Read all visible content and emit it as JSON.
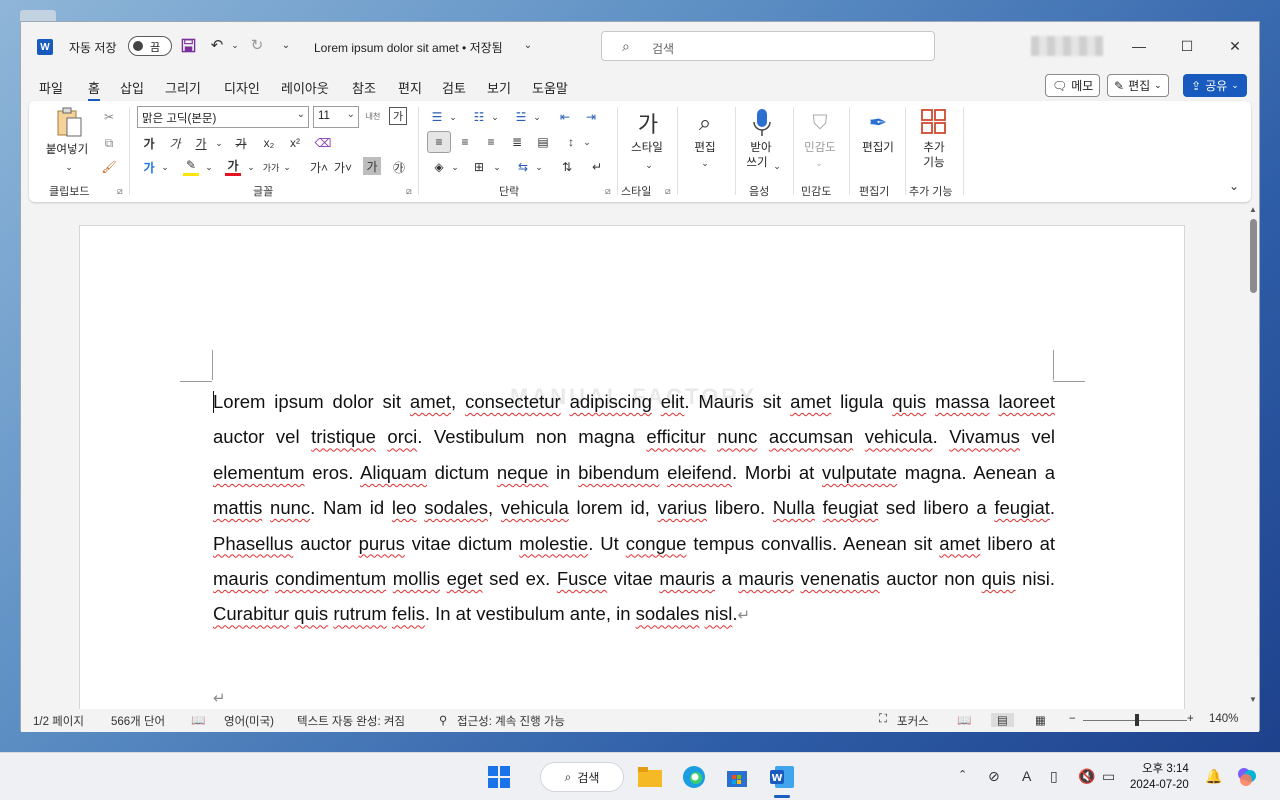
{
  "titlebar": {
    "app_icon": "W",
    "autosave_label": "자동 저장",
    "autosave_state": "끔",
    "doc_title": "Lorem ipsum dolor sit amet • 저장됨",
    "search_placeholder": "검색"
  },
  "menu": {
    "items": [
      "파일",
      "홈",
      "삽입",
      "그리기",
      "디자인",
      "레이아웃",
      "참조",
      "편지",
      "검토",
      "보기",
      "도움말"
    ],
    "active": "홈",
    "comment_label": "메모",
    "edit_label": "편집",
    "share_label": "공유"
  },
  "ribbon": {
    "clipboard": {
      "paste_label": "붙여넣기",
      "group_label": "클립보드"
    },
    "font": {
      "font_name": "맑은 고딕(본문)",
      "font_size": "11",
      "group_label": "글꼴",
      "bold": "가",
      "italic": "가",
      "underline": "가",
      "strike": "가",
      "sub": "x₂",
      "sup": "x²",
      "grow": "가˄",
      "shrink": "가˅",
      "case_btn": "가가",
      "char_shade": "가",
      "enclose": "㉮",
      "highlight_color": "#ffe600",
      "font_color_bar": "#e81123",
      "text_effect": "가",
      "phonetic": "내천",
      "char_border": "가"
    },
    "paragraph": {
      "group_label": "단락"
    },
    "styles": {
      "label": "스타일",
      "group_label": "스타일"
    },
    "editing": {
      "label": "편집"
    },
    "voice": {
      "label_line1": "받아",
      "label_line2": "쓰기",
      "group_label": "음성"
    },
    "sensitivity": {
      "label": "민감도",
      "group_label": "민감도"
    },
    "editor": {
      "label": "편집기",
      "group_label": "편집기"
    },
    "addins": {
      "label_line1": "추가",
      "label_line2": "기능",
      "group_label": "추가 기능"
    }
  },
  "document": {
    "watermark": "MANUAL FACTORY",
    "runs": [
      {
        "t": "Lorem ipsum dolor sit ",
        "s": false
      },
      {
        "t": "amet",
        "s": true
      },
      {
        "t": ", ",
        "s": false
      },
      {
        "t": "consectetur",
        "s": true
      },
      {
        "t": " ",
        "s": false
      },
      {
        "t": "adipiscing",
        "s": true
      },
      {
        "t": " ",
        "s": false
      },
      {
        "t": "elit",
        "s": true
      },
      {
        "t": ". Mauris sit ",
        "s": false
      },
      {
        "t": "amet",
        "s": true
      },
      {
        "t": " ligula ",
        "s": false
      },
      {
        "t": "quis",
        "s": true
      },
      {
        "t": " ",
        "s": false
      },
      {
        "t": "massa",
        "s": true
      },
      {
        "t": " ",
        "s": false
      },
      {
        "t": "laoreet",
        "s": true
      },
      {
        "t": " auctor vel ",
        "s": false
      },
      {
        "t": "tristique",
        "s": true
      },
      {
        "t": " ",
        "s": false
      },
      {
        "t": "orci",
        "s": true
      },
      {
        "t": ". Vestibulum non magna ",
        "s": false
      },
      {
        "t": "efficitur",
        "s": true
      },
      {
        "t": " ",
        "s": false
      },
      {
        "t": "nunc",
        "s": true
      },
      {
        "t": " ",
        "s": false
      },
      {
        "t": "accumsan",
        "s": true
      },
      {
        "t": " ",
        "s": false
      },
      {
        "t": "vehicula",
        "s": true
      },
      {
        "t": ". ",
        "s": false
      },
      {
        "t": "Vivamus",
        "s": true
      },
      {
        "t": " vel ",
        "s": false
      },
      {
        "t": "elementum",
        "s": true
      },
      {
        "t": " eros. ",
        "s": false
      },
      {
        "t": "Aliquam",
        "s": true
      },
      {
        "t": " dictum ",
        "s": false
      },
      {
        "t": "neque",
        "s": true
      },
      {
        "t": " in ",
        "s": false
      },
      {
        "t": "bibendum",
        "s": true
      },
      {
        "t": " ",
        "s": false
      },
      {
        "t": "eleifend",
        "s": true
      },
      {
        "t": ". Morbi at ",
        "s": false
      },
      {
        "t": "vulputate",
        "s": true
      },
      {
        "t": " magna. Aenean a ",
        "s": false
      },
      {
        "t": "mattis",
        "s": true
      },
      {
        "t": " ",
        "s": false
      },
      {
        "t": "nunc",
        "s": true
      },
      {
        "t": ". Nam id ",
        "s": false
      },
      {
        "t": "leo",
        "s": true
      },
      {
        "t": " ",
        "s": false
      },
      {
        "t": "sodales",
        "s": true
      },
      {
        "t": ", ",
        "s": false
      },
      {
        "t": "vehicula",
        "s": true
      },
      {
        "t": " lorem id, ",
        "s": false
      },
      {
        "t": "varius",
        "s": true
      },
      {
        "t": " libero. ",
        "s": false
      },
      {
        "t": "Nulla",
        "s": true
      },
      {
        "t": " ",
        "s": false
      },
      {
        "t": "feugiat",
        "s": true
      },
      {
        "t": " sed libero a ",
        "s": false
      },
      {
        "t": "feugiat",
        "s": true
      },
      {
        "t": ". ",
        "s": false
      },
      {
        "t": "Phasellus",
        "s": true
      },
      {
        "t": " auctor ",
        "s": false
      },
      {
        "t": "purus",
        "s": true
      },
      {
        "t": " vitae dictum ",
        "s": false
      },
      {
        "t": "molestie",
        "s": true
      },
      {
        "t": ". Ut ",
        "s": false
      },
      {
        "t": "congue",
        "s": true
      },
      {
        "t": " tempus convallis. Aenean sit ",
        "s": false
      },
      {
        "t": "amet",
        "s": true
      },
      {
        "t": " libero at ",
        "s": false
      },
      {
        "t": "mauris",
        "s": true
      },
      {
        "t": " ",
        "s": false
      },
      {
        "t": "condimentum",
        "s": true
      },
      {
        "t": " ",
        "s": false
      },
      {
        "t": "mollis",
        "s": true
      },
      {
        "t": " ",
        "s": false
      },
      {
        "t": "eget",
        "s": true
      },
      {
        "t": " sed ex. ",
        "s": false
      },
      {
        "t": "Fusce",
        "s": true
      },
      {
        "t": " vitae ",
        "s": false
      },
      {
        "t": "mauris",
        "s": true
      },
      {
        "t": " a ",
        "s": false
      },
      {
        "t": "mauris",
        "s": true
      },
      {
        "t": " ",
        "s": false
      },
      {
        "t": "venenatis",
        "s": true
      },
      {
        "t": " auctor non ",
        "s": false
      },
      {
        "t": "quis",
        "s": true
      },
      {
        "t": " nisi. ",
        "s": false
      },
      {
        "t": "Curabitur",
        "s": true
      },
      {
        "t": " ",
        "s": false
      },
      {
        "t": "quis",
        "s": true
      },
      {
        "t": " ",
        "s": false
      },
      {
        "t": "rutrum",
        "s": true
      },
      {
        "t": " ",
        "s": false
      },
      {
        "t": "felis",
        "s": true
      },
      {
        "t": ". In at vestibulum ante, in ",
        "s": false
      },
      {
        "t": "sodales",
        "s": true
      },
      {
        "t": " ",
        "s": false
      },
      {
        "t": "nisl",
        "s": true
      },
      {
        "t": ".",
        "s": false
      }
    ],
    "pilcrow": "↵"
  },
  "status": {
    "page": "1/2 페이지",
    "words": "566개 단어",
    "language": "영어(미국)",
    "autocomplete": "텍스트 자동 완성: 켜짐",
    "accessibility": "접근성: 계속 진행 가능",
    "focus": "포커스",
    "zoom_minus": "−",
    "zoom_plus": "+",
    "zoom": "140%"
  },
  "taskbar": {
    "search_label": "검색",
    "time": "오후 3:14",
    "date": "2024-07-20"
  }
}
